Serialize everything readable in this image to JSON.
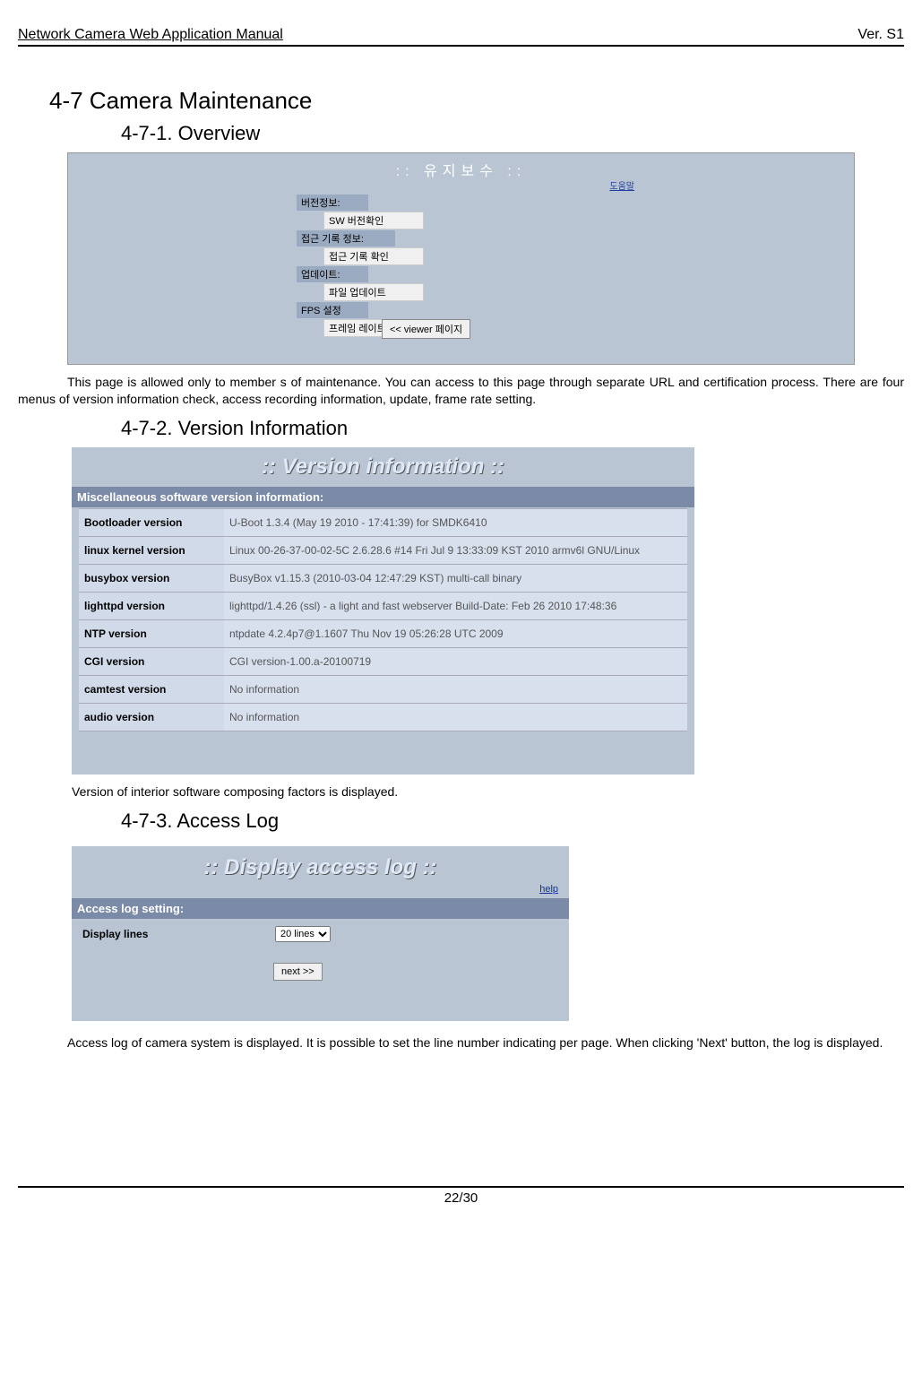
{
  "header": {
    "left": "Network Camera Web Application Manual",
    "right": "Ver. S1"
  },
  "sections": {
    "h1": "4-7   Camera Maintenance",
    "h2_1": "4-7-1.    Overview",
    "h2_2": "4-7-2.    Version Information",
    "h2_3": "4-7-3.    Access Log"
  },
  "paragraphs": {
    "p1": "This page is allowed only to member s of maintenance. You can access to this page through separate URL and certification process. There are four menus of version information check, access recording information, update, frame rate setting.",
    "p2": "Version of interior software composing factors is displayed.",
    "p3": "Access log of camera system is displayed.   It is possible to set the line number indicating per page. When clicking 'Next' button, the log is displayed."
  },
  "screenshot1": {
    "title": ":: 유지보수 ::",
    "help": "도움말",
    "menus": [
      {
        "head": "버전정보:",
        "item": "SW 버전확인"
      },
      {
        "head": "접근 기록 정보:",
        "item": "접근 기록 확인"
      },
      {
        "head": "업데이트:",
        "item": "파일 업데이트"
      },
      {
        "head": "FPS 설정",
        "item": "프레임 레이트 설정"
      }
    ],
    "button": "<< viewer 페이지"
  },
  "screenshot2": {
    "title": ":: Version information ::",
    "subhead": "Miscellaneous software version information:",
    "rows": [
      {
        "k": "Bootloader version",
        "v": "U-Boot 1.3.4 (May 19 2010 - 17:41:39) for SMDK6410"
      },
      {
        "k": "linux kernel version",
        "v": "Linux 00-26-37-00-02-5C 2.6.28.6 #14 Fri Jul 9 13:33:09 KST 2010 armv6l GNU/Linux"
      },
      {
        "k": "busybox version",
        "v": "BusyBox v1.15.3 (2010-03-04 12:47:29 KST) multi-call binary"
      },
      {
        "k": "lighttpd version",
        "v": "lighttpd/1.4.26 (ssl) - a light and fast webserver Build-Date: Feb 26 2010 17:48:36"
      },
      {
        "k": "NTP version",
        "v": "ntpdate 4.2.4p7@1.1607 Thu Nov 19 05:26:28 UTC 2009"
      },
      {
        "k": "CGI version",
        "v": "CGI version-1.00.a-20100719"
      },
      {
        "k": "camtest version",
        "v": "No information"
      },
      {
        "k": "audio version",
        "v": "No information"
      }
    ]
  },
  "screenshot3": {
    "title": ":: Display access log ::",
    "help": "help",
    "subhead": "Access log setting:",
    "label": "Display lines",
    "select_value": "20 lines",
    "button": "next >>"
  },
  "footer": {
    "page": "22/30"
  }
}
